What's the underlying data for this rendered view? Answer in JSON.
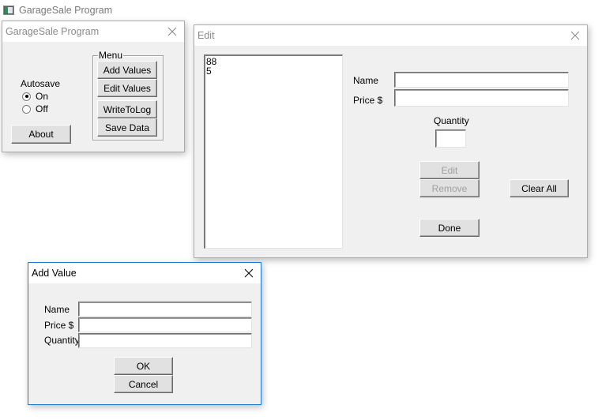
{
  "taskbar": {
    "title": "GarageSale Program",
    "icon": "app-window-icon"
  },
  "main_window": {
    "title": "GarageSale Program",
    "autosave": {
      "label": "Autosave",
      "options": [
        {
          "label": "On",
          "checked": true
        },
        {
          "label": "Off",
          "checked": false
        }
      ]
    },
    "about_label": "About",
    "menu": {
      "legend": "Menu",
      "buttons": [
        "Add Values",
        "Edit Values",
        "WriteToLog",
        "Save Data"
      ]
    }
  },
  "edit_window": {
    "title": "Edit",
    "list_items": [
      "88",
      "5"
    ],
    "name_label": "Name",
    "name_value": "",
    "price_label": "Price  $",
    "price_value": "",
    "quantity_label": "Quantity",
    "quantity_value": "",
    "edit_label": "Edit",
    "remove_label": "Remove",
    "clear_all_label": "Clear All",
    "done_label": "Done"
  },
  "add_window": {
    "title": "Add Value",
    "name_label": "Name",
    "name_value": "",
    "price_label": "Price  $",
    "price_value": "",
    "quantity_label": "Quantity",
    "quantity_value": "",
    "ok_label": "OK",
    "cancel_label": "Cancel"
  }
}
